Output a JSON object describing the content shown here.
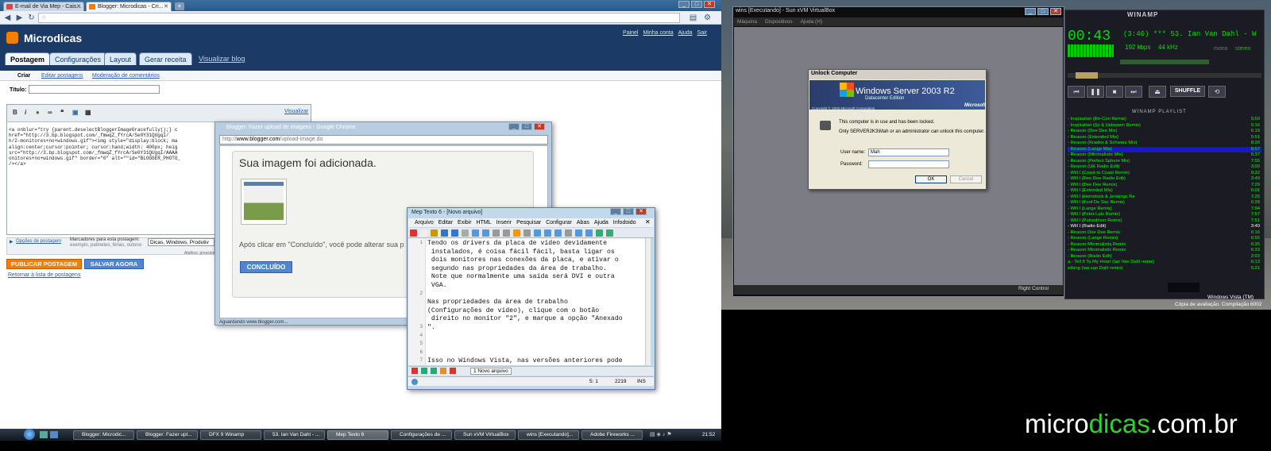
{
  "chrome": {
    "tabs": [
      {
        "label": "E-mail de Via Mep - Cais..."
      },
      {
        "label": "Blogger: Microdicas - Cri..."
      }
    ],
    "new_tab": "+"
  },
  "blogger": {
    "title": "Microdicas",
    "toplinks": [
      "Painel",
      "Minha conta",
      "Ajuda",
      "Sair"
    ],
    "tabs": [
      "Postagem",
      "Configurações",
      "Layout",
      "Gerar receita",
      "Visualizar blog"
    ],
    "subnav": [
      "Criar",
      "Editar postagens",
      "Moderação de comentários"
    ],
    "title_label": "Título:",
    "visualizar": "Visualizar",
    "code": "<a onblur=\"try {parent.deselectBloggerImageGracefully();} c\nhref=\"http://3.bp.blogspot.com/_fmwqZ_fYrcA/Se0Y31QUgqI/\nh/2-monitores+no+windows.gif\"><img style=\"display:block; ma\nalign:center;cursor:pointer; cursor:hand;width: 400px; heig\nsrc=\"http://3.bp.blogspot.com/_fmwqZ_fYrcA/Se0Y31QUgqI/AAAA\nonitores+no+windows.gif\" border=\"0\" alt=\"\"id=\"BLOGGER_PHOTO_\n/></a>",
    "opcoes": "Opções de postagem",
    "marcadores_label": "Marcadores para esta postagem:",
    "marcadores_hint": "exemplo, patinetes, férias, outono",
    "marcadores_value": "Dicas, Windows, Produtiv",
    "atalhos": "Atalhos: pressione Ctrl com: B = Negrito, I = Itálico",
    "publicar": "PUBLICAR POSTAGEM",
    "salvar": "SALVAR AGORA",
    "retornar": "Retornar à lista de postagens"
  },
  "upload": {
    "title": "Blogger: Fazer upload de imagens - Google Chrome",
    "address_prefix": "http://",
    "address_host": "www.blogger.com",
    "address_path": "/upload-image.do",
    "heading": "Sua imagem foi adicionada.",
    "message": "Após clicar em \"Concluído\", você pode alterar sua p",
    "button": "CONCLUÍDO",
    "status": "Aguardando www.blogger.com..."
  },
  "mep": {
    "title": "Mep Texto 6 - [Novo arquivo]",
    "menu": [
      "Arquivo",
      "Editar",
      "Exibir",
      "HTML",
      "Inserir",
      "Pesquisar",
      "Configurar",
      "Abas",
      "Ajuda",
      "Infodoido"
    ],
    "lines": [
      "1",
      "",
      "",
      "",
      "",
      "",
      "2",
      "",
      "",
      "",
      "3",
      "4",
      "5",
      "6",
      "7"
    ],
    "text": "Tendo os drivers da placa de vídeo devidamente\n instalados, é coisa fácil fácil, basta ligar os\n dois monitores nas conexões da placa, e ativar o\n segundo nas propriedades da área de trabalho.\n Note que normalmente uma saída será DVI e outra\n VGA.\n\nNas propriedades da área de trabalho\n(Configurações de vídeo), clique com o botão\n direito no monitor \"2\", e marque a opção \"Anexado\n\".\n\n\n\nIsso no Windows Vista, nas versões anteriores pode",
    "tab": "1 Novo arquivo",
    "status_pos": "5: 1",
    "status_size": "2219",
    "status_mode": "INS"
  },
  "vbox": {
    "title": "wins [Executando] - Sun xVM VirtualBox",
    "menu": [
      "Máquina",
      "Dispositivos",
      "Ajuda (H)"
    ],
    "right_ctrl": "Right Control"
  },
  "unlock": {
    "title": "Unlock Computer",
    "brand": "Windows Server 2003 R2",
    "edition": "Datacenter Edition",
    "ms": "Microsoft",
    "copyright": "Copyright © 2005  Microsoft Corporation",
    "msg1": "This computer is in use and has been locked.",
    "msg2": "Only SERVER2K3\\Mah or an administrator can unlock this computer.",
    "user_label": "User name:",
    "user_value": "Mah",
    "pass_label": "Password:",
    "ok": "OK",
    "cancel": "Cancel"
  },
  "winamp": {
    "title": "WINAMP",
    "time": "00:43",
    "track": "(3:40) *** 53. Ian Van Dahl - W",
    "kbps": "192 kbps",
    "khz": "44 kHz",
    "mono": "mono",
    "stereo": "stereo",
    "shuffle": "SHUFFLE",
    "playlist_title": "WINAMP PLAYLIST",
    "playlist": [
      {
        "t": "- Inspiration (Re-Con Remix)",
        "d": "5:50"
      },
      {
        "t": "- Inspiration (Sy & Unknown Remix)",
        "d": "5:16"
      },
      {
        "t": "- Reason (Dee Dee Mix)",
        "d": "6:19"
      },
      {
        "t": "- Reason (Extended Mix)",
        "d": "5:51"
      },
      {
        "t": "- Reason (Kraxler & Schwarz Mix)",
        "d": "8:20"
      },
      {
        "t": "- Reason (Lange Mix)",
        "d": "8:57"
      },
      {
        "t": "- Reason (Minimalistix Mix)",
        "d": "6:37"
      },
      {
        "t": "- Reason (Perfect Sphere Mix)",
        "d": "7:55"
      },
      {
        "t": "- Reason (UK Radio Edit)",
        "d": "3:00"
      },
      {
        "t": "- Will I (Coast to Coast Remix)",
        "d": "9:32"
      },
      {
        "t": "- Will I (Dee Dee Radio Edit)",
        "d": "3:49"
      },
      {
        "t": "- Will I (Dee Dee Remix)",
        "d": "7:29"
      },
      {
        "t": "- Will I (Extended Mix)",
        "d": "6:01"
      },
      {
        "t": "- Will I (Hemstock & Jennings Re",
        "d": "7:25"
      },
      {
        "t": "- Will I (Kool De Sac Remix)",
        "d": "6:28"
      },
      {
        "t": "- Will I (Lange Remix)",
        "d": "7:04"
      },
      {
        "t": "- Will I (Peter Luts Remix)",
        "d": "7:57"
      },
      {
        "t": "- Will I (Pulsedriver Remix)",
        "d": "7:51"
      },
      {
        "t": "- Will I (Radio Edit)",
        "d": "3:40"
      },
      {
        "t": "- Reason  Dee Dee Remix",
        "d": "6:16"
      },
      {
        "t": "- Reason (Lange Remix)",
        "d": "6:55"
      },
      {
        "t": "- Reason  Minimalistix Remix",
        "d": "6:35"
      },
      {
        "t": "- Reason  Minimalistix Remix",
        "d": "6:33"
      },
      {
        "t": "- Reason (Radio Edit)",
        "d": "3:03"
      },
      {
        "t": "a - Tell It To My Heart (Ian Van Dahl remix)",
        "d": "6:13"
      },
      {
        "t": "ething (ian van Dahl remix)",
        "d": "5:21"
      }
    ],
    "selected_index": 5,
    "current_index": 18
  },
  "vista": {
    "line1": "Windows Vista (TM)",
    "line2": "Cópia de avaliação. Compilação 6002"
  },
  "taskbar": {
    "items": [
      "Blogger: Microdic...",
      "Blogger: Fazer upl...",
      "DFX 9 Winamp",
      "53. Ian Van Dahl - ...",
      "Mep Texto 6",
      "Configurações de ...",
      "Sun xVM VirtualBox",
      "wins [Executando]...",
      "Adobe Fireworks ..."
    ],
    "active_index": 4,
    "clock": "21:52"
  },
  "brand": {
    "part1": "micro",
    "part2": "dicas",
    "part3": ".com.br"
  },
  "colors": {
    "blogger_header": "#1b3a66",
    "blogger_orange": "#f57d00",
    "winamp_green": "#00e000",
    "brand_green": "#2fd12f"
  }
}
